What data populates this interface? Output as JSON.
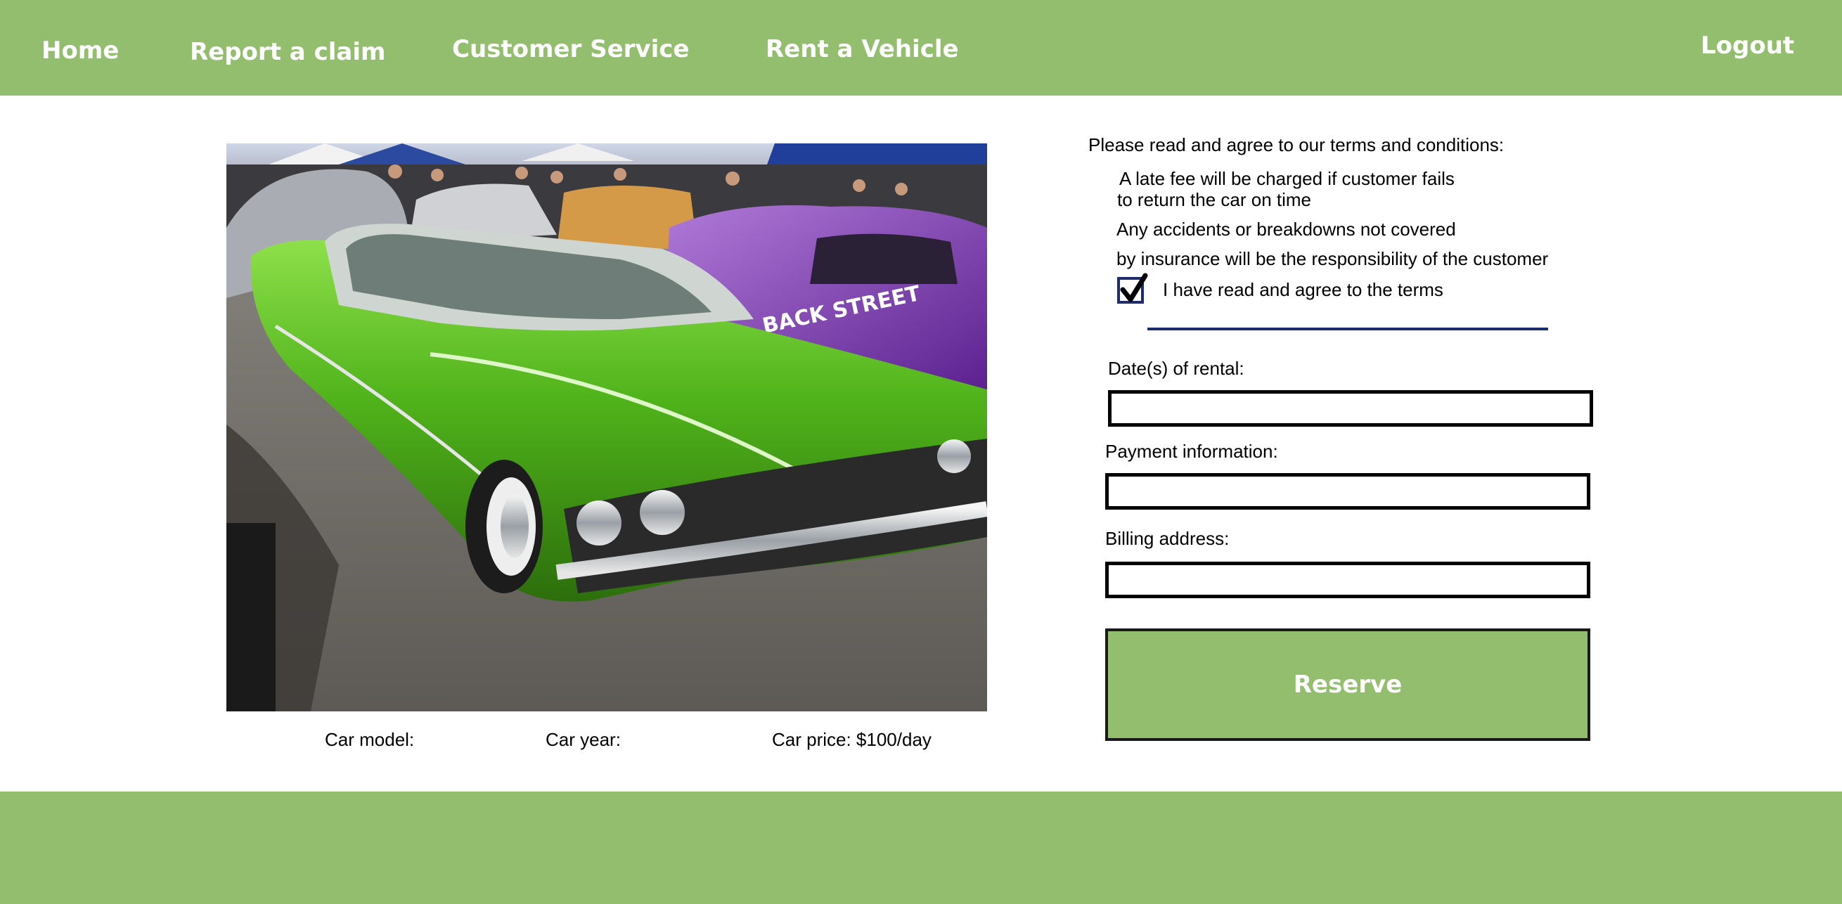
{
  "nav": {
    "home": "Home",
    "report_claim": "Report a claim",
    "customer_service": "Customer Service",
    "rent_vehicle": "Rent a Vehicle",
    "logout": "Logout"
  },
  "car": {
    "model_label": "Car model:",
    "year_label": "Car year:",
    "price_label": "Car price: $100/day",
    "photo_text": "BACK STREET"
  },
  "terms": {
    "heading": "Please read and agree to our terms and conditions:",
    "line1": "A late fee will be charged if customer fails",
    "line2": "to return the car on time",
    "line3": "Any accidents or breakdowns not covered",
    "line4": "by insurance will be the responsibility of the customer",
    "agree_label": "I have read and agree to the terms",
    "agree_checked": true
  },
  "form": {
    "dates_label": "Date(s) of rental:",
    "dates_value": "",
    "payment_label": "Payment information:",
    "payment_value": "",
    "billing_label": "Billing address:",
    "billing_value": "",
    "reserve_label": "Reserve"
  },
  "colors": {
    "brand_green": "#92be6d",
    "border_navy": "#1e2d6b",
    "white": "#ffffff"
  },
  "icons": {
    "checkbox": "checkmark-icon"
  }
}
